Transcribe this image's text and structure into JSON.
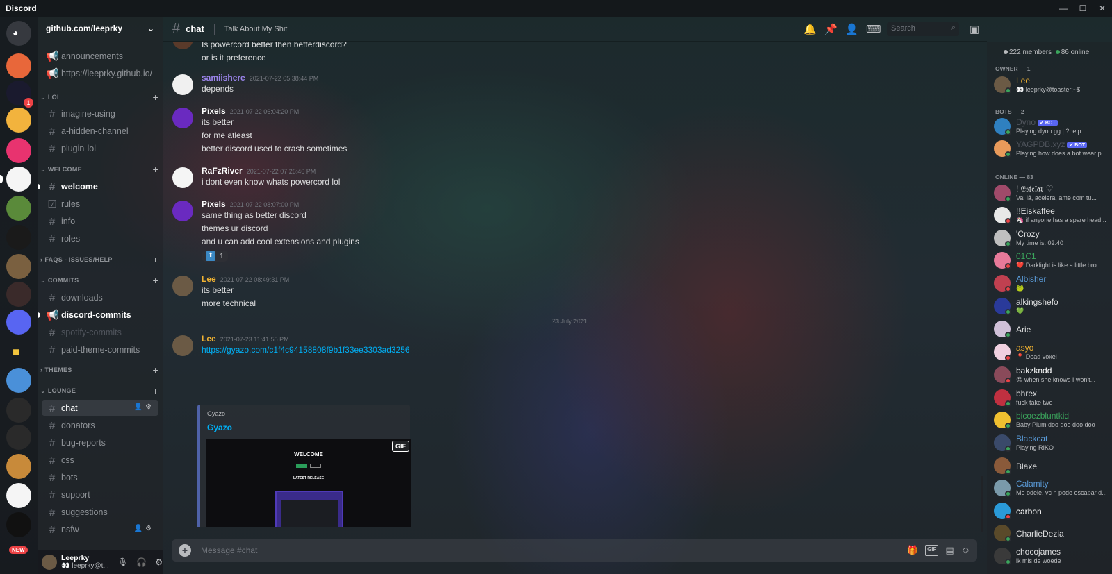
{
  "app": {
    "title": "Discord",
    "min": "—",
    "max": "☐",
    "close": "✕"
  },
  "server": {
    "name": "github.com/leeprky",
    "chevron": "⌄"
  },
  "guilds": [
    {
      "color": "#36393f",
      "label": "discord-home"
    },
    {
      "color": "#e8673a"
    },
    {
      "color": "#1a1a2e",
      "badge": "1"
    },
    {
      "color": "#f2b33d"
    },
    {
      "color": "#e8336f"
    },
    {
      "color": "#f5f5f5"
    },
    {
      "color": "#5a8a3a"
    },
    {
      "color": "#1a1a1a"
    },
    {
      "color": "#7a6040"
    },
    {
      "color": "#3a2a2a"
    },
    {
      "color": "#5865f2"
    },
    {
      "color": "#f2c43d",
      "label": "folder"
    },
    {
      "color": "#4a90d9"
    },
    {
      "color": "#2a2a2a"
    },
    {
      "color": "#2a2a2a"
    },
    {
      "color": "#c88a3a"
    },
    {
      "color": "#f5f5f5"
    },
    {
      "color": "#111"
    }
  ],
  "new_badge": "NEW",
  "channels": {
    "top": [
      {
        "name": "announcements",
        "icon": "📢"
      },
      {
        "name": "https://leeprky.github.io/",
        "icon": "📢"
      }
    ],
    "categories": [
      {
        "name": "LOL",
        "items": [
          "imagine-using",
          "a-hidden-channel",
          "plugin-lol"
        ]
      },
      {
        "name": "WELCOME",
        "items": [
          "welcome",
          "rules",
          "info",
          "roles"
        ]
      },
      {
        "name": "FAQS - ISSUES/HELP",
        "items": []
      },
      {
        "name": "COMMITS",
        "items": [
          "downloads",
          "discord-commits",
          "spotify-commits",
          "paid-theme-commits"
        ]
      },
      {
        "name": "THEMES",
        "items": []
      },
      {
        "name": "LOUNGE",
        "items": [
          "chat",
          "donators",
          "bug-reports",
          "css",
          "bots",
          "support",
          "suggestions",
          "nsfw"
        ]
      }
    ]
  },
  "user": {
    "name": "Leeprky",
    "status": "👀 leeprky@t..."
  },
  "header": {
    "channel": "chat",
    "topic": "Talk About My Shit",
    "search_placeholder": "Search"
  },
  "messages": [
    {
      "lines": [
        "Is powercord better then betterdiscord?",
        "or is it preference"
      ]
    },
    {
      "author": "samiishere",
      "ts": "2021-07-22 05:38:44 PM",
      "color": "#9b84ec",
      "lines": [
        "depends"
      ]
    },
    {
      "author": "Pixels",
      "ts": "2021-07-22 06:04:20 PM",
      "color": "#ffffff",
      "lines": [
        "its better",
        "for me atleast",
        "better discord used to crash sometimes"
      ]
    },
    {
      "author": "RaFzRiver",
      "ts": "2021-07-22 07:26:46 PM",
      "color": "#ffffff",
      "lines": [
        "i dont even know whats powercord lol"
      ]
    },
    {
      "author": "Pixels",
      "ts": "2021-07-22 08:07:00 PM",
      "color": "#ffffff",
      "lines": [
        "same thing as better discord",
        "themes ur discord",
        "and u can add cool extensions and plugins"
      ],
      "reaction": {
        "emoji": "⬆",
        "count": "1"
      }
    },
    {
      "author": "Lee",
      "ts": "2021-07-22 08:49:31 PM",
      "color": "#f0b232",
      "lines": [
        "its better",
        "more technical"
      ]
    },
    {
      "author": "Lee",
      "ts": "2021-07-23 11:41:55 PM",
      "color": "#f0b232",
      "lines": [
        "https://gyazo.com/c1f4c94158808f9b1f33ee3303ad3256"
      ]
    }
  ],
  "date_divider": "23 July 2021",
  "embed": {
    "provider": "Gyazo",
    "title": "Gyazo",
    "gif": "GIF",
    "welcome": "WELCOME",
    "latest": "LATEST RELEASE"
  },
  "composer": {
    "placeholder": "Message #chat",
    "gif": "GIF"
  },
  "members": {
    "total": "222 members",
    "online": "86 online",
    "groups": [
      {
        "label": "OWNER — 1"
      },
      {
        "label": "BOTS — 2"
      },
      {
        "label": "ONLINE — 83"
      }
    ],
    "list": [
      {
        "name": "Lee",
        "color": "#f0b232",
        "activity": "👀 leeprky@toaster:~$",
        "status": "#3ba55c",
        "av": "#6b5a45"
      },
      {
        "name": "Dyno",
        "color": "#4f545c",
        "activity": "Playing dyno.gg | ?help",
        "status": "#3ba55c",
        "av": "#2f80c0",
        "bot": "✔ BOT"
      },
      {
        "name": "YAGPDB.xyz",
        "color": "#4f545c",
        "activity": "Playing how does a bot wear p...",
        "status": "#3ba55c",
        "av": "#e89a5a",
        "bot": "✔ BOT"
      },
      {
        "name": "! 𝔈𝔰𝔱𝔢𝔩𝔞𝔯 ♡",
        "color": "#dcddde",
        "activity": "Vai lá, acelera, ame com tu...",
        "status": "#3ba55c",
        "av": "#a04a6a"
      },
      {
        "name": "!!Eiskaffee",
        "color": "#dcddde",
        "activity": "🦄 if anyone has a spare head...",
        "status": "#ed4245",
        "av": "#e8e8e8"
      },
      {
        "name": "'Crozy",
        "color": "#dcddde",
        "activity": "My time is: 02:40",
        "status": "#3ba55c",
        "av": "#bfbfbf"
      },
      {
        "name": "01C1",
        "color": "#3ba55c",
        "activity": "❤️ Darklight is like a little bro...",
        "status": "#ed4245",
        "av": "#e87a9a"
      },
      {
        "name": "Albisher",
        "color": "#5a9bd8",
        "activity": "🐸",
        "status": "#ed4245",
        "av": "#c04050"
      },
      {
        "name": "alkingshefo",
        "color": "#dcddde",
        "activity": "💚",
        "status": "#3ba55c",
        "av": "#2a3a9a"
      },
      {
        "name": "Arie",
        "color": "#dcddde",
        "activity": "",
        "status": "#3ba55c",
        "av": "#d0c0d8"
      },
      {
        "name": "asyo",
        "color": "#f0b232",
        "activity": "📍 Dead voxel",
        "status": "#ed4245",
        "av": "#f0d0e0"
      },
      {
        "name": "bakzkndd",
        "color": "#ffffff",
        "activity": "😍 when she knows I won't...",
        "status": "#ed4245",
        "av": "#8a4a5a"
      },
      {
        "name": "bhrex",
        "color": "#dcddde",
        "activity": "fuck take two",
        "status": "#3ba55c",
        "av": "#c03040"
      },
      {
        "name": "bicoezbluntkid",
        "color": "#3ba55c",
        "activity": "Baby Plum doo doo doo doo",
        "status": "#3ba55c",
        "av": "#f0c030"
      },
      {
        "name": "Blackcat",
        "color": "#5a9bd8",
        "activity": "Playing RIKO",
        "status": "#3ba55c",
        "av": "#3a4a6a"
      },
      {
        "name": "Blaxe",
        "color": "#dcddde",
        "activity": "",
        "status": "#3ba55c",
        "av": "#8a5a3a"
      },
      {
        "name": "Calamity",
        "color": "#5a9bd8",
        "activity": "Me odeie, vc n pode escapar d...",
        "status": "#3ba55c",
        "av": "#7a9aaa"
      },
      {
        "name": "carbon",
        "color": "#ffffff",
        "activity": "",
        "status": "#ed4245",
        "av": "#2a9ad8"
      },
      {
        "name": "CharlieDezia",
        "color": "#dcddde",
        "activity": "",
        "status": "#3ba55c",
        "av": "#5a4a2a"
      },
      {
        "name": "chocojames",
        "color": "#dcddde",
        "activity": "ik mis de woede",
        "status": "#3ba55c",
        "av": "#3a3a3a"
      }
    ]
  }
}
